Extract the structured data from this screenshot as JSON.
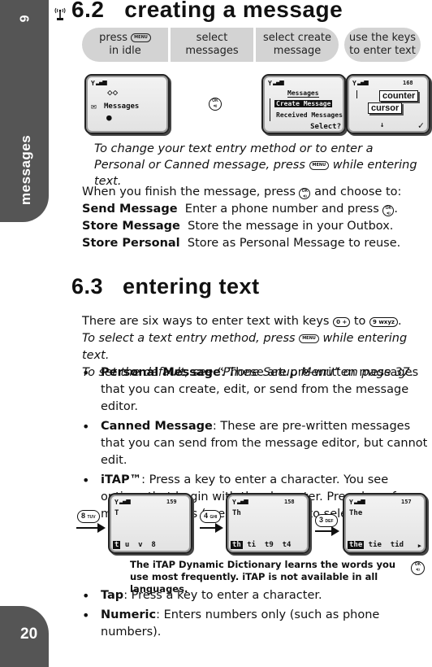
{
  "sidebar": {
    "chapter_number": "6",
    "chapter_label": "messages",
    "page_number": "20"
  },
  "section_62": {
    "heading": "6.2   creating a message",
    "icon": "antenna-icon",
    "steps": [
      {
        "pre": "press",
        "key": "MENU",
        "post": "in idle"
      },
      {
        "line1": "select",
        "line2": "messages"
      },
      {
        "line1": "select create",
        "line2": "message"
      },
      {
        "line1": "use the keys",
        "line2": "to enter text"
      }
    ],
    "screens": {
      "idle_menu": {
        "label": "Messages"
      },
      "ok_key": {
        "top": "OK",
        "bottom": "◂))"
      },
      "messages_menu": {
        "title": "Messages",
        "items": [
          "Create Message",
          "Received Messages"
        ],
        "softkey": "Select?"
      },
      "editor": {
        "counter": "168",
        "callout_counter": "counter",
        "callout_cursor": "cursor"
      }
    },
    "caption_pre": "To change your text entry method or to enter a Personal or Canned message, press",
    "caption_key": "MENU",
    "caption_post": "while entering text.",
    "finish": {
      "intro_pre": "When you finish the message, press",
      "intro_post": "and choose to:",
      "options": [
        {
          "term": "Send Message",
          "desc_pre": "Enter a phone number and press",
          "desc_post": "."
        },
        {
          "term": "Store Message",
          "desc_pre": "Store the message in your Outbox.",
          "desc_post": ""
        },
        {
          "term": "Store Personal",
          "desc_pre": "Store as Personal Message to reuse.",
          "desc_post": ""
        }
      ]
    }
  },
  "section_63": {
    "heading": "6.3   entering text",
    "intro_pre": "There are six ways to enter text with keys",
    "key_from": "0 +",
    "intro_mid": "to",
    "key_to": "9 wxyz",
    "intro_post": ".",
    "italic1_pre": "To select a text entry method, press",
    "italic1_key": "MENU",
    "italic1_post": "while entering text.",
    "italic2": "To set the default, see “Phone Setup Menu” on page 37.",
    "bullets": [
      {
        "term": "Personal Message",
        "text": ": These are pre-written messages that you can create, edit, or send from the message editor."
      },
      {
        "term": "Canned Message",
        "text": ": These are pre-written messages that you can send from the message editor, but cannot edit."
      },
      {
        "term": "iTAP™",
        "text_pre": ": Press a key to enter a character. You see options that begin with the character. Press keys for more characters (press",
        "nav_key": "▴   ▾",
        "text_mid": "and",
        "text_post": "to select an option)."
      }
    ],
    "itap_demo": [
      {
        "key": "8",
        "key_sub": "TUV",
        "counter": "159",
        "typed": "T",
        "highlight": "t",
        "options": " u  v  8"
      },
      {
        "key": "4",
        "key_sub": "GHI",
        "counter": "158",
        "typed": "Th",
        "highlight": "th",
        "options": " ti  t9  t4"
      },
      {
        "key": "3",
        "key_sub": "DEF",
        "counter": "157",
        "typed": "The",
        "highlight": "the",
        "options": " tie  tid"
      }
    ],
    "itap_caption": "The iTAP Dynamic Dictionary learns the words you use most frequently. iTAP is not available in all languages.",
    "bullets2": [
      {
        "term": "Tap",
        "text": ": Press a key to enter a character."
      },
      {
        "term": "Numeric",
        "text": ": Enters numbers only (such as phone numbers)."
      }
    ]
  }
}
